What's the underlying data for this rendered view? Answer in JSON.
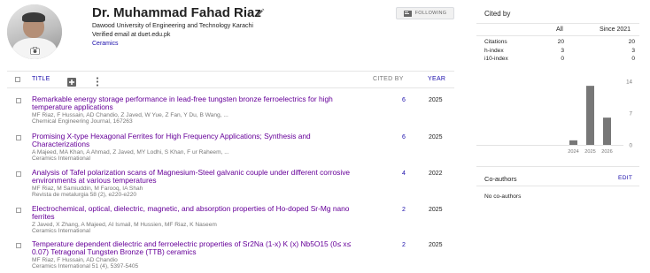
{
  "profile": {
    "name": "Dr. Muhammad Fahad Riaz",
    "affiliation": "Dawood University of Engineering and Technology Karachi",
    "verified": "Verified email at duet.edu.pk",
    "interest": "Ceramics",
    "follow_label": "FOLLOWING"
  },
  "table": {
    "title_header": "TITLE",
    "cited_header": "CITED BY",
    "year_header": "YEAR"
  },
  "articles": [
    {
      "title": "Remarkable energy storage performance in lead-free tungsten bronze ferroelectrics for high temperature applications",
      "authors": "MF Riaz, F Hussain, AD Chandio, Z Javed, W Yue, Z Fan, Y Du, B Wang, ...",
      "venue": "Chemical Engineering Journal, 167263",
      "cited": "6",
      "year": "2025"
    },
    {
      "title": "Promising X-type Hexagonal Ferrites for High Frequency Applications; Synthesis and Characterizations",
      "authors": "A Majeed, MA Khan, A Ahmad, Z Javed, MY Lodhi, S Khan, F ur Raheem, ...",
      "venue": "Ceramics International",
      "cited": "6",
      "year": "2025"
    },
    {
      "title": "Analysis of Tafel polarization scans of Magnesium-Steel galvanic couple under different corrosive environments at various temperatures",
      "authors": "MF Riaz, M Samiuddin, M Farooq, IA Shah",
      "venue": "Revista de metalurgia 58 (2), e220-e220",
      "cited": "4",
      "year": "2022"
    },
    {
      "title": "Electrochemical, optical, dielectric, magnetic, and absorption properties of Ho-doped Sr-Mg nano ferrites",
      "authors": "Z Javed, X Zhang, A Majeed, AI Ismail, M Hussien, MF Riaz, K Naseem",
      "venue": "Ceramics International",
      "cited": "2",
      "year": "2025"
    },
    {
      "title": "Temperature dependent dielectric and ferroelectric properties of Sr2Na (1-x) K (x) Nb5O15 (0≤ x≤ 0.07) Tetragonal Tungsten Bronze (TTB) ceramics",
      "authors": "MF Riaz, F Hussain, AD Chandio",
      "venue": "Ceramics International 51 (4), 5397-5405",
      "cited": "2",
      "year": "2025"
    }
  ],
  "cited_by": {
    "title": "Cited by",
    "col_all": "All",
    "col_since": "Since 2021",
    "metrics": [
      {
        "label": "Citations",
        "all": "20",
        "since": "20"
      },
      {
        "label": "h-index",
        "all": "3",
        "since": "3"
      },
      {
        "label": "i10-index",
        "all": "0",
        "since": "0"
      }
    ]
  },
  "chart_data": {
    "type": "bar",
    "categories": [
      "2024",
      "2025",
      "2026"
    ],
    "values": [
      1,
      13,
      6
    ],
    "ylim": [
      0,
      14
    ],
    "yticks": [
      "14",
      "7",
      "0"
    ],
    "bar_color": "#777777"
  },
  "coauthors": {
    "title": "Co-authors",
    "edit_label": "EDIT",
    "empty_text": "No co-authors"
  },
  "colors": {
    "link": "#1a0dab",
    "visited": "#660099",
    "muted": "#777777"
  }
}
